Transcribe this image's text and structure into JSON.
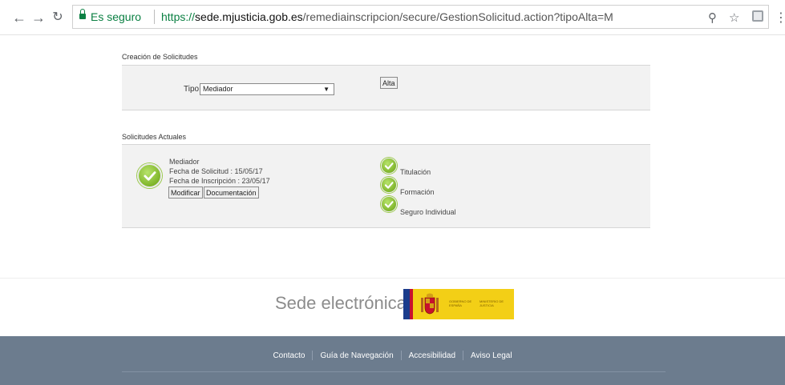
{
  "browser": {
    "secure_label": "Es seguro",
    "url_scheme": "https://",
    "url_host": "sede.mjusticia.gob.es",
    "url_path": "/remediainscripcion/secure/GestionSolicitud.action?tipoAlta=M"
  },
  "creation": {
    "title": "Creación de Solicitudes",
    "tipo_label": "Tipo:",
    "tipo_value": "Mediador",
    "alta_label": "Alta"
  },
  "current": {
    "title": "Solicitudes Actuales",
    "item": {
      "type": "Mediador",
      "fecha_solicitud": "Fecha de Solicitud : 15/05/17",
      "fecha_inscripcion": "Fecha de Inscripción : 23/05/17",
      "modificar_label": "Modificar",
      "documentacion_label": "Documentación"
    },
    "requirements": [
      {
        "label": "Titulación"
      },
      {
        "label": "Formación"
      },
      {
        "label": "Seguro Individual"
      }
    ]
  },
  "footer": {
    "brand": "Sede electrónica",
    "gov_text_1": "GOBIERNO DE ESPAÑA",
    "gov_text_2": "MINISTERIO DE JUSTICIA",
    "links": [
      "Contacto",
      "Guía de Navegación",
      "Accesibilidad",
      "Aviso Legal"
    ]
  },
  "colors": {
    "accent_green": "#7fb52b",
    "footer_bar": "#6c7c8e",
    "panel_bg": "#f2f2f2"
  }
}
